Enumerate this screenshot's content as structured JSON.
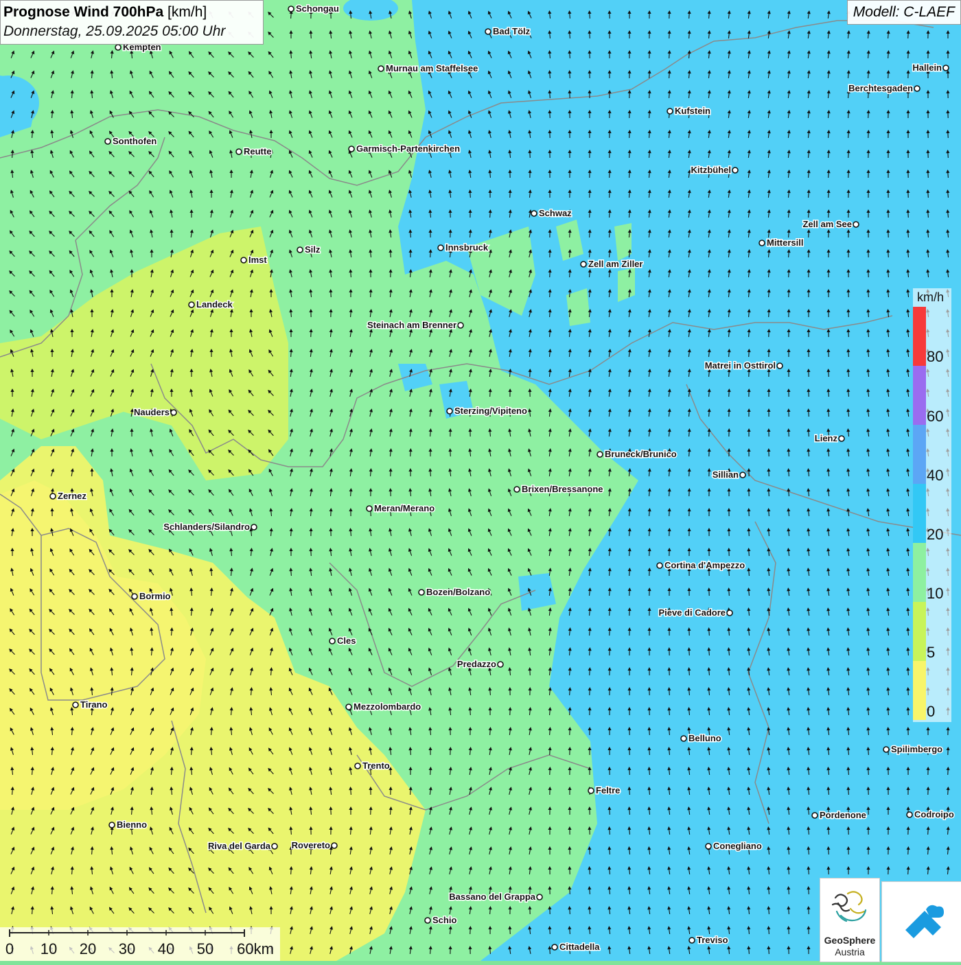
{
  "header": {
    "title": "Prognose Wind 700hPa",
    "unit": "[km/h]",
    "datetime": "Donnerstag, 25.09.2025 05:00 Uhr"
  },
  "model": {
    "label": "Modell: C-LAEF"
  },
  "legend": {
    "unit": "km/h",
    "ticks": [
      "80",
      "60",
      "40",
      "20",
      "10",
      "5",
      "0"
    ],
    "colors": [
      "#f73a3a",
      "#9a6cf0",
      "#5ca6f5",
      "#33c8f5",
      "#8ef0a0",
      "#c8f45a",
      "#f8f56a"
    ]
  },
  "scale": {
    "labels": [
      "0",
      "10",
      "20",
      "30",
      "40",
      "50",
      "60km"
    ]
  },
  "logos": {
    "geosphere_line1": "GeoSphere",
    "geosphere_line2": "Austria"
  },
  "places": [
    {
      "name": "Schongau"
    },
    {
      "name": "Bad Tölz"
    },
    {
      "name": "Kempten"
    },
    {
      "name": "Murnau am Staffelsee"
    },
    {
      "name": "Hallein"
    },
    {
      "name": "Berchtesgaden"
    },
    {
      "name": "Kufstein"
    },
    {
      "name": "Sonthofen"
    },
    {
      "name": "Reutte"
    },
    {
      "name": "Garmisch-Partenkirchen"
    },
    {
      "name": "Kitzbühel"
    },
    {
      "name": "Schwaz"
    },
    {
      "name": "Zell am See"
    },
    {
      "name": "Innsbruck"
    },
    {
      "name": "Silz"
    },
    {
      "name": "Mittersill"
    },
    {
      "name": "Imst"
    },
    {
      "name": "Zell am Ziller"
    },
    {
      "name": "Landeck"
    },
    {
      "name": "Steinach am Brenner"
    },
    {
      "name": "Matrei in Osttirol"
    },
    {
      "name": "Nauders"
    },
    {
      "name": "Sterzing/Vipiteno"
    },
    {
      "name": "Lienz"
    },
    {
      "name": "Bruneck/Brunico"
    },
    {
      "name": "Sillian"
    },
    {
      "name": "Brixen/Bressanone"
    },
    {
      "name": "Zernez"
    },
    {
      "name": "Meran/Merano"
    },
    {
      "name": "Schlanders/Silandro"
    },
    {
      "name": "Cortina d'Ampezzo"
    },
    {
      "name": "Bozen/Bolzano"
    },
    {
      "name": "Bormio"
    },
    {
      "name": "Pieve di Cadore"
    },
    {
      "name": "Cles"
    },
    {
      "name": "Predazzo"
    },
    {
      "name": "Tirano"
    },
    {
      "name": "Mezzolombardo"
    },
    {
      "name": "Belluno"
    },
    {
      "name": "Spilimbergo"
    },
    {
      "name": "Trento"
    },
    {
      "name": "Feltre"
    },
    {
      "name": "Pordenone"
    },
    {
      "name": "Codroipo"
    },
    {
      "name": "Bienno"
    },
    {
      "name": "Riva del Garda"
    },
    {
      "name": "Rovereto"
    },
    {
      "name": "Conegliano"
    },
    {
      "name": "Bassano del Grappa"
    },
    {
      "name": "Schio"
    },
    {
      "name": "Treviso"
    },
    {
      "name": "Cittadella"
    }
  ]
}
